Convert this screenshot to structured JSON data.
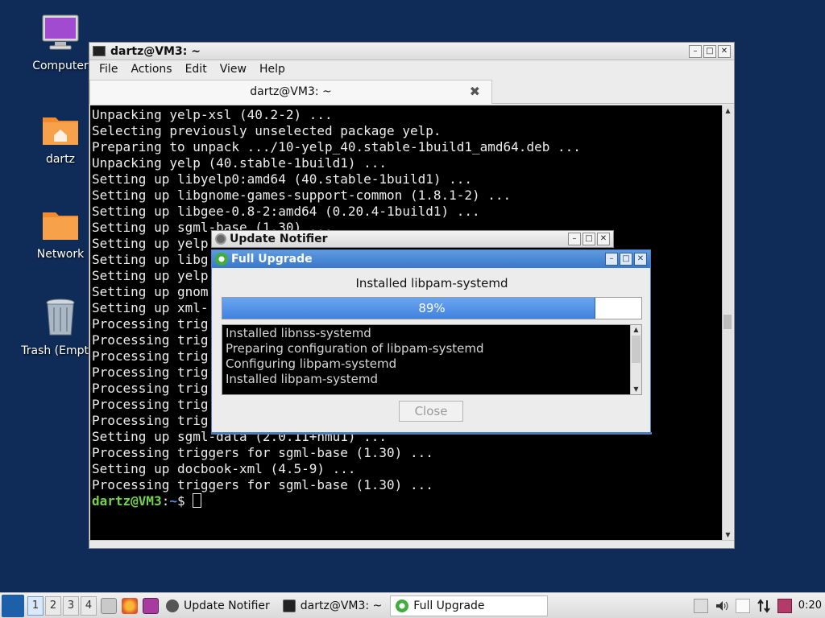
{
  "desktop": {
    "icons": [
      {
        "label": "Computer"
      },
      {
        "label": "dartz"
      },
      {
        "label": "Network"
      },
      {
        "label": "Trash (Empty)"
      }
    ]
  },
  "terminal": {
    "title": "dartz@VM3: ~",
    "menu": [
      "File",
      "Actions",
      "Edit",
      "View",
      "Help"
    ],
    "tab_label": "dartz@VM3: ~",
    "lines": [
      "Unpacking yelp-xsl (40.2-2) ...",
      "Selecting previously unselected package yelp.",
      "Preparing to unpack .../10-yelp_40.stable-1build1_amd64.deb ...",
      "Unpacking yelp (40.stable-1build1) ...",
      "Setting up libyelp0:amd64 (40.stable-1build1) ...",
      "Setting up libgnome-games-support-common (1.8.1-2) ...",
      "Setting up libgee-0.8-2:amd64 (0.20.4-1build1) ...",
      "Setting up sgml-base (1.30) ...",
      "Setting up yelp",
      "Setting up libg",
      "Setting up yelp",
      "Setting up gnom",
      "Setting up xml-",
      "Processing trig",
      "Processing trig",
      "Processing trig",
      "Processing trig",
      "Processing trig",
      "Processing trig",
      "Processing trig",
      "Setting up sgml-data (2.0.11+nmu1) ...",
      "Processing triggers for sgml-base (1.30) ...",
      "Setting up docbook-xml (4.5-9) ...",
      "Processing triggers for sgml-base (1.30) ..."
    ],
    "prompt_user": "dartz@VM3",
    "prompt_sep": ":",
    "prompt_path": "~",
    "prompt_symbol": "$ "
  },
  "notifier": {
    "title": "Update Notifier"
  },
  "upgrade": {
    "title": "Full Upgrade",
    "status": "Installed libpam-systemd",
    "progress_label": "89%",
    "progress": 0.89,
    "log": [
      "Installed libnss-systemd",
      "Preparing configuration of libpam-systemd",
      "Configuring libpam-systemd",
      "Installed libpam-systemd"
    ],
    "close_label": "Close"
  },
  "taskbar": {
    "workspaces": [
      "1",
      "2",
      "3",
      "4"
    ],
    "tasks": [
      {
        "label": "Update Notifier"
      },
      {
        "label": "dartz@VM3: ~"
      },
      {
        "label": "Full Upgrade"
      }
    ],
    "clock": "0:20"
  },
  "colors": {
    "desktop_bg": "#0f2b57",
    "progress_fill": "#3f82df",
    "prompt_user": "#74d34a",
    "prompt_path": "#5b8de6"
  }
}
